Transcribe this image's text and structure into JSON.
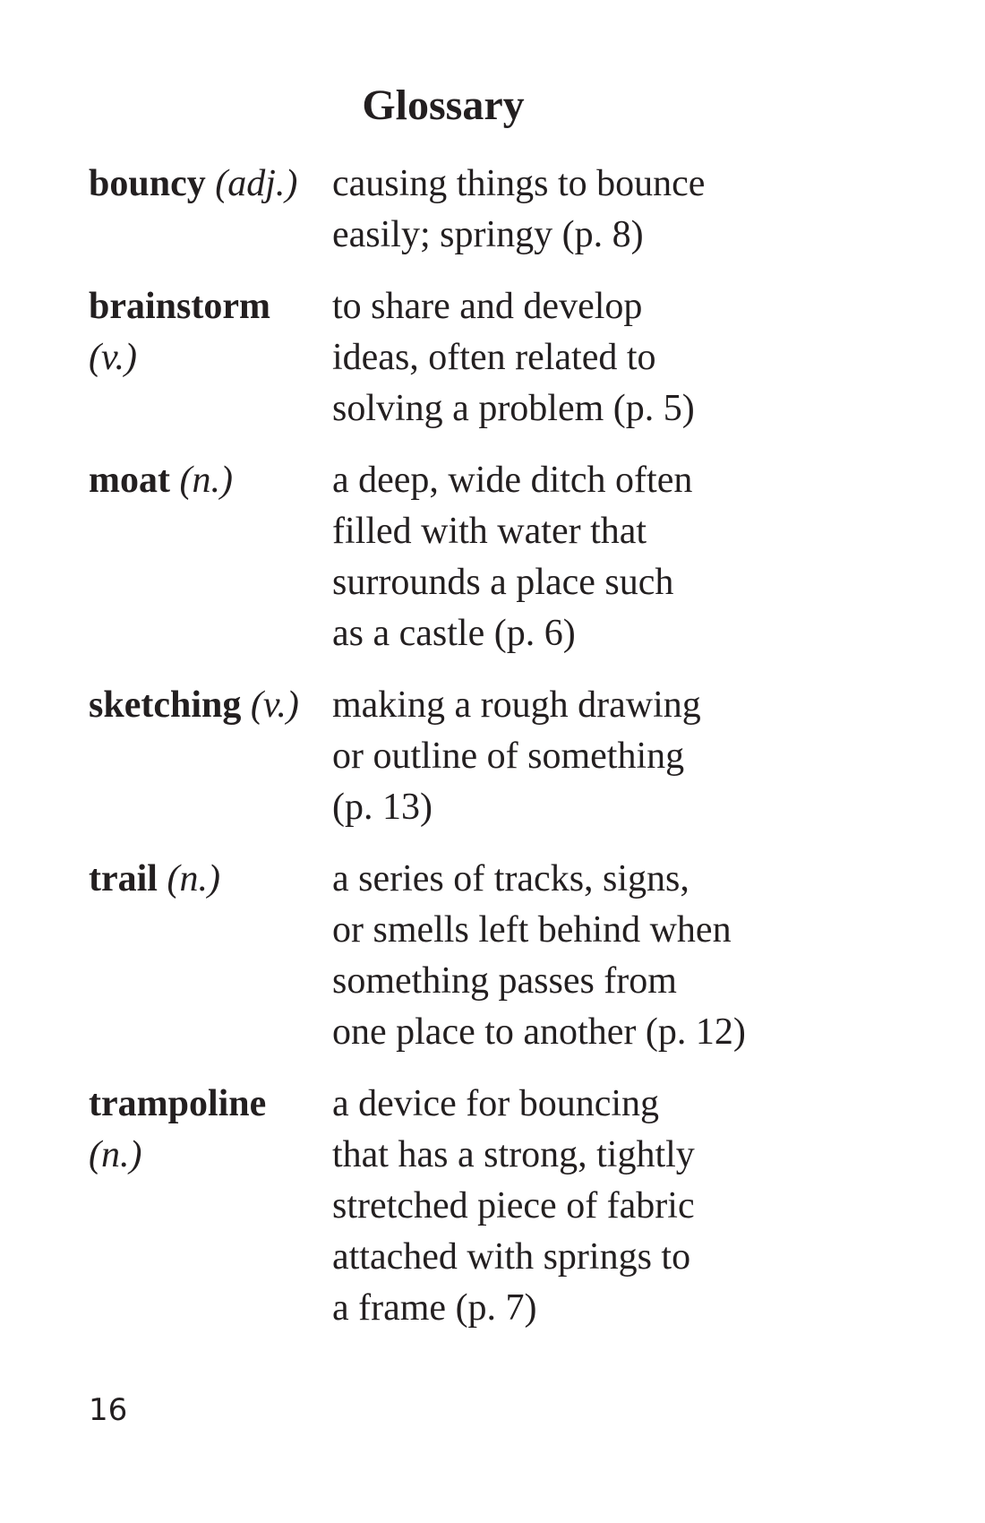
{
  "title": "Glossary",
  "entries": [
    {
      "term": "bouncy",
      "pos": "(adj.)",
      "definition": "causing things to bounce\neasily; springy (p. 8)"
    },
    {
      "term": "brainstorm",
      "pos": "(v.)",
      "definition": "to share and develop\nideas, often related to\nsolving a problem (p. 5)"
    },
    {
      "term": "moat",
      "pos": "(n.)",
      "definition": "a deep, wide ditch often\nfilled with water that\nsurrounds a place such\nas a castle (p. 6)"
    },
    {
      "term": "sketching",
      "pos": "(v.)",
      "definition": "making a rough drawing\nor outline of something\n(p. 13)"
    },
    {
      "term": "trail",
      "pos": "(n.)",
      "definition": "a series of tracks, signs,\nor smells left behind when\nsomething passes from\none place to another (p. 12)"
    },
    {
      "term": "trampoline",
      "pos": "(n.)",
      "definition": "a device for bouncing\nthat has a strong, tightly\nstretched piece of fabric\nattached with springs to\na frame (p. 7)"
    }
  ],
  "page_number": "16"
}
